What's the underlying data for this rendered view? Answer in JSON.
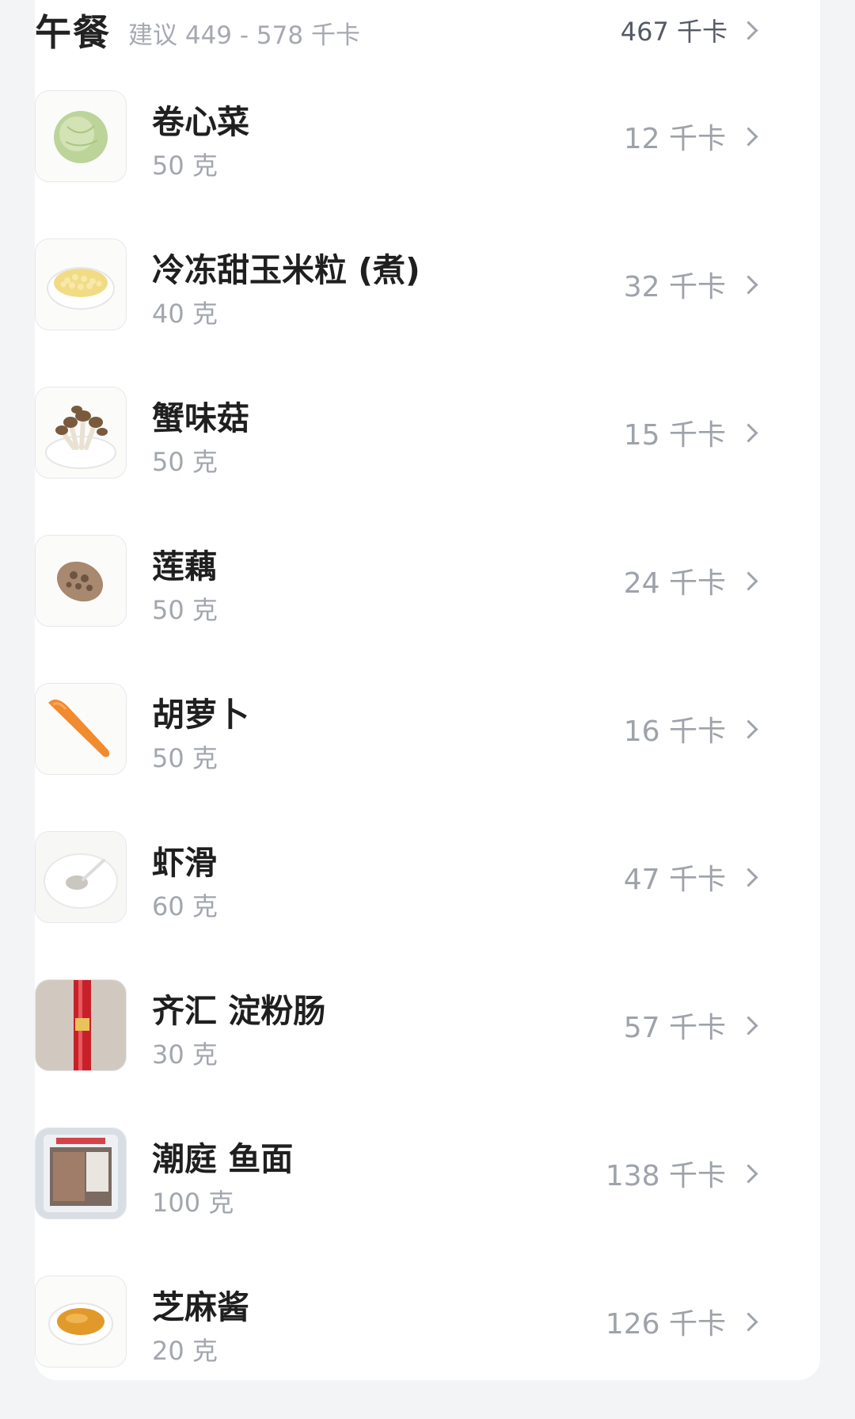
{
  "meal": {
    "title": "午餐",
    "suggestion": "建议 449 - 578 千卡",
    "total": "467 千卡"
  },
  "items": [
    {
      "name": "卷心菜",
      "amount": "50 克",
      "kcal": "12 千卡",
      "icon": "cabbage-icon"
    },
    {
      "name": "冷冻甜玉米粒 (煮)",
      "amount": "40 克",
      "kcal": "32 千卡",
      "icon": "corn-icon"
    },
    {
      "name": "蟹味菇",
      "amount": "50 克",
      "kcal": "15 千卡",
      "icon": "mushroom-icon"
    },
    {
      "name": "莲藕",
      "amount": "50 克",
      "kcal": "24 千卡",
      "icon": "lotus-root-icon"
    },
    {
      "name": "胡萝卜",
      "amount": "50 克",
      "kcal": "16 千卡",
      "icon": "carrot-icon"
    },
    {
      "name": "虾滑",
      "amount": "60 克",
      "kcal": "47 千卡",
      "icon": "shrimp-paste-icon"
    },
    {
      "name": "齐汇 淀粉肠",
      "amount": "30 克",
      "kcal": "57 千卡",
      "icon": "sausage-icon"
    },
    {
      "name": "潮庭 鱼面",
      "amount": "100 克",
      "kcal": "138 千卡",
      "icon": "fish-noodle-icon"
    },
    {
      "name": "芝麻酱",
      "amount": "20 克",
      "kcal": "126 千卡",
      "icon": "sesame-paste-icon"
    }
  ]
}
